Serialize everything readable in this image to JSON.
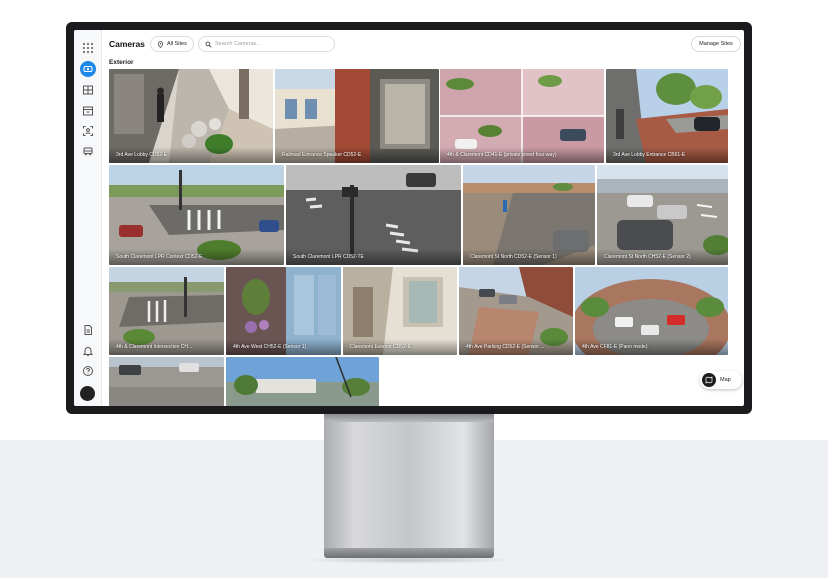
{
  "header": {
    "title": "Cameras",
    "sites_filter": "All Sites",
    "search_placeholder": "Search Cameras...",
    "manage_button": "Manage Sites"
  },
  "section": {
    "label": "Exterior"
  },
  "cameras": [
    {
      "label": "3rd Ave Lobby CD52-E",
      "scene": "lobby"
    },
    {
      "label": "Railroad Entrance Speaker CD52-E",
      "scene": "building"
    },
    {
      "label": "4th & Claremont CD41-E (private street four-way)",
      "scene": "quad"
    },
    {
      "label": "3rd Ave Lobby Entrance CB61-E",
      "scene": "sidewalk"
    },
    {
      "label": "South Claremont LPR Context CD52-E",
      "scene": "intersection"
    },
    {
      "label": "South Claremont LPR CD52-TE",
      "scene": "grayscale"
    },
    {
      "label": "Claremont St North CD52-E (Sensor 1)",
      "scene": "road"
    },
    {
      "label": "Claremont St North CH52-E (Sensor 2)",
      "scene": "parking"
    },
    {
      "label": "4th & Claremont Intersection CH...",
      "scene": "intersection2"
    },
    {
      "label": "4th Ave West CH52-E (Sensor 1)",
      "scene": "glass"
    },
    {
      "label": "Claremont Exterior CD52-E",
      "scene": "wall"
    },
    {
      "label": "4th Ave Parking CD52-E (Sensor ...",
      "scene": "parking2"
    },
    {
      "label": "4th Ave CF81-E (Pano mode)",
      "scene": "fisheye"
    },
    {
      "label": "",
      "scene": "street"
    },
    {
      "label": "",
      "scene": "sky"
    }
  ],
  "map_button": {
    "label": "Map"
  },
  "colors": {
    "accent": "#1f87e8",
    "bezel": "#1b1b1d",
    "floor": "#eef0f4"
  }
}
